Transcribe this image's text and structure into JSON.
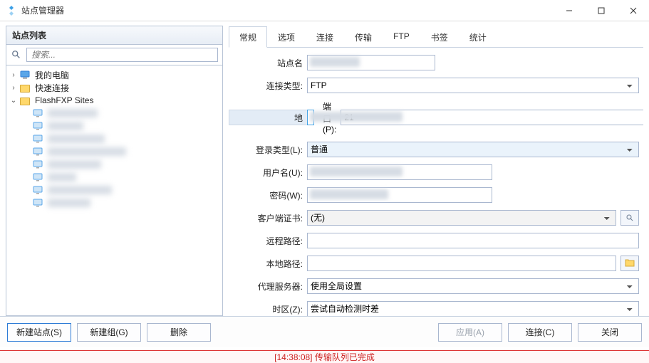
{
  "window": {
    "title": "站点管理器"
  },
  "sidebar": {
    "header": "站点列表",
    "search_placeholder": "搜索...",
    "items": [
      {
        "kind": "pc",
        "label": "我的电脑",
        "level": 0
      },
      {
        "kind": "folder",
        "label": "快速连接",
        "level": 0
      },
      {
        "kind": "folder",
        "label": "FlashFXP Sites",
        "level": 0,
        "expanded": true
      },
      {
        "kind": "site",
        "label": "██████",
        "level": 1,
        "blur_w": 70
      },
      {
        "kind": "site",
        "label": "████",
        "level": 1,
        "blur_w": 50
      },
      {
        "kind": "site",
        "label": "██████",
        "level": 1,
        "blur_w": 80
      },
      {
        "kind": "site",
        "label": "████████",
        "level": 1,
        "blur_w": 110
      },
      {
        "kind": "site",
        "label": "██████",
        "level": 1,
        "blur_w": 75
      },
      {
        "kind": "site",
        "label": "████",
        "level": 1,
        "blur_w": 40
      },
      {
        "kind": "site",
        "label": "██████",
        "level": 1,
        "blur_w": 90
      },
      {
        "kind": "site",
        "label": "██████",
        "level": 1,
        "blur_w": 60
      }
    ]
  },
  "tabs": [
    "常规",
    "选项",
    "连接",
    "传输",
    "FTP",
    "书签",
    "统计"
  ],
  "active_tab": 0,
  "form": {
    "site_name_label": "站点名",
    "conn_type_label": "连接类型:",
    "conn_type_value": "FTP",
    "addr_label": "地",
    "port_label": "端口(P):",
    "port_value": "21",
    "login_type_label": "登录类型(L):",
    "login_type_value": "普通",
    "user_label": "用户名(U):",
    "pass_label": "密码(W):",
    "cert_label": "客户端证书:",
    "cert_value": "(无)",
    "remote_label": "远程路径:",
    "local_label": "本地路径:",
    "proxy_label": "代理服务器:",
    "proxy_value": "使用全局设置",
    "tz_label": "时区(Z):",
    "tz_value": "尝试自动检测时差"
  },
  "footer": {
    "new_site": "新建站点(S)",
    "new_group": "新建组(G)",
    "delete": "删除",
    "apply": "应用(A)",
    "connect": "连接(C)",
    "close": "关闭"
  },
  "status_text": "[14:38:08] 传输队列已完成"
}
